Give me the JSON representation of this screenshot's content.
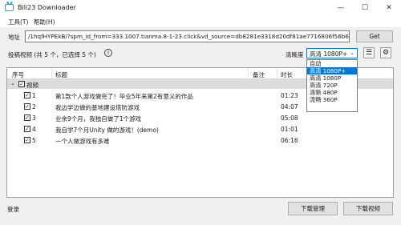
{
  "window": {
    "title": "Bili23 Downloader",
    "minimize": "—",
    "maximize": "☐",
    "close": "✕"
  },
  "menu": {
    "tools": "工具(T)",
    "help": "帮助(H)"
  },
  "address": {
    "label": "地址",
    "value": "/1hqfHYPEkB/?spm_id_from=333.1007.tianma.8-1-23.click&vd_source=db8281e3318d20df81ae7716806f56b6",
    "get_button": "Get"
  },
  "info": {
    "text": "投稿视频 (共 5 个，已选择 5 个)",
    "icon": "i"
  },
  "quality": {
    "label": "清晰度",
    "selected": "高清 1080P+",
    "options": [
      "自动",
      "高清 1080P+",
      "高清 1080P",
      "高清 720P",
      "清晰 480P",
      "流畅 360P"
    ],
    "selected_index": 1
  },
  "tools": {
    "list_icon": "☰",
    "settings_icon": "⚙"
  },
  "table": {
    "columns": [
      "序号",
      "标题",
      "备注",
      "时长"
    ],
    "group": "视频",
    "rows": [
      {
        "index": "1",
        "title": "第1款个人游戏做完了！毕业5年来第2有意义的作品",
        "note": "",
        "duration": "01:23"
      },
      {
        "index": "2",
        "title": "我边学边做的基地建设塔防游戏",
        "note": "",
        "duration": "04:07"
      },
      {
        "index": "3",
        "title": "业余9个月，我独自做了1个游戏",
        "note": "",
        "duration": "05:08"
      },
      {
        "index": "4",
        "title": "我自学7个月Unity 做的游戏！(demo)",
        "note": "",
        "duration": "01:01"
      },
      {
        "index": "5",
        "title": "一个人做游戏有多难",
        "note": "",
        "duration": "06:16"
      }
    ]
  },
  "footer": {
    "login": "登录",
    "manage_button": "下载管理",
    "download_button": "下载视频"
  }
}
